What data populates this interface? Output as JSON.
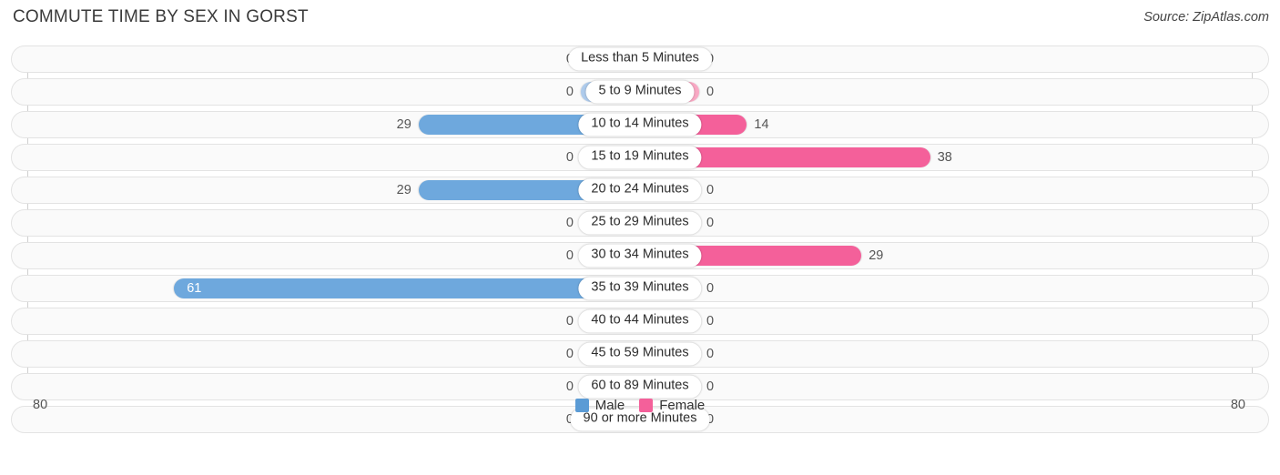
{
  "header": {
    "title": "COMMUTE TIME BY SEX IN GORST",
    "source": "Source: ZipAtlas.com"
  },
  "axis": {
    "left_label": "80",
    "right_label": "80"
  },
  "legend": {
    "male_label": "Male",
    "female_label": "Female"
  },
  "colors": {
    "male_active": "#6ea8dd",
    "male_zero": "#aecbec",
    "female_active": "#f4609a",
    "female_zero": "#f9a9c4",
    "legend_male": "#5b9bd5",
    "legend_female": "#f4609a"
  },
  "chart_data": {
    "type": "bar",
    "title": "COMMUTE TIME BY SEX IN GORST",
    "subtitle": "Source: ZipAtlas.com",
    "orientation": "horizontal-diverging",
    "xlabel": "",
    "ylabel": "",
    "xlim": [
      80,
      80
    ],
    "axis_left_max": 80,
    "axis_right_max": 80,
    "grid": false,
    "legend_position": "bottom-center",
    "categories": [
      "Less than 5 Minutes",
      "5 to 9 Minutes",
      "10 to 14 Minutes",
      "15 to 19 Minutes",
      "20 to 24 Minutes",
      "25 to 29 Minutes",
      "30 to 34 Minutes",
      "35 to 39 Minutes",
      "40 to 44 Minutes",
      "45 to 59 Minutes",
      "60 to 89 Minutes",
      "90 or more Minutes"
    ],
    "series": [
      {
        "name": "Male",
        "side": "left",
        "values": [
          0,
          0,
          29,
          0,
          29,
          0,
          0,
          61,
          0,
          0,
          0,
          0
        ]
      },
      {
        "name": "Female",
        "side": "right",
        "values": [
          0,
          0,
          14,
          38,
          0,
          0,
          29,
          0,
          0,
          0,
          0,
          0
        ]
      }
    ]
  }
}
